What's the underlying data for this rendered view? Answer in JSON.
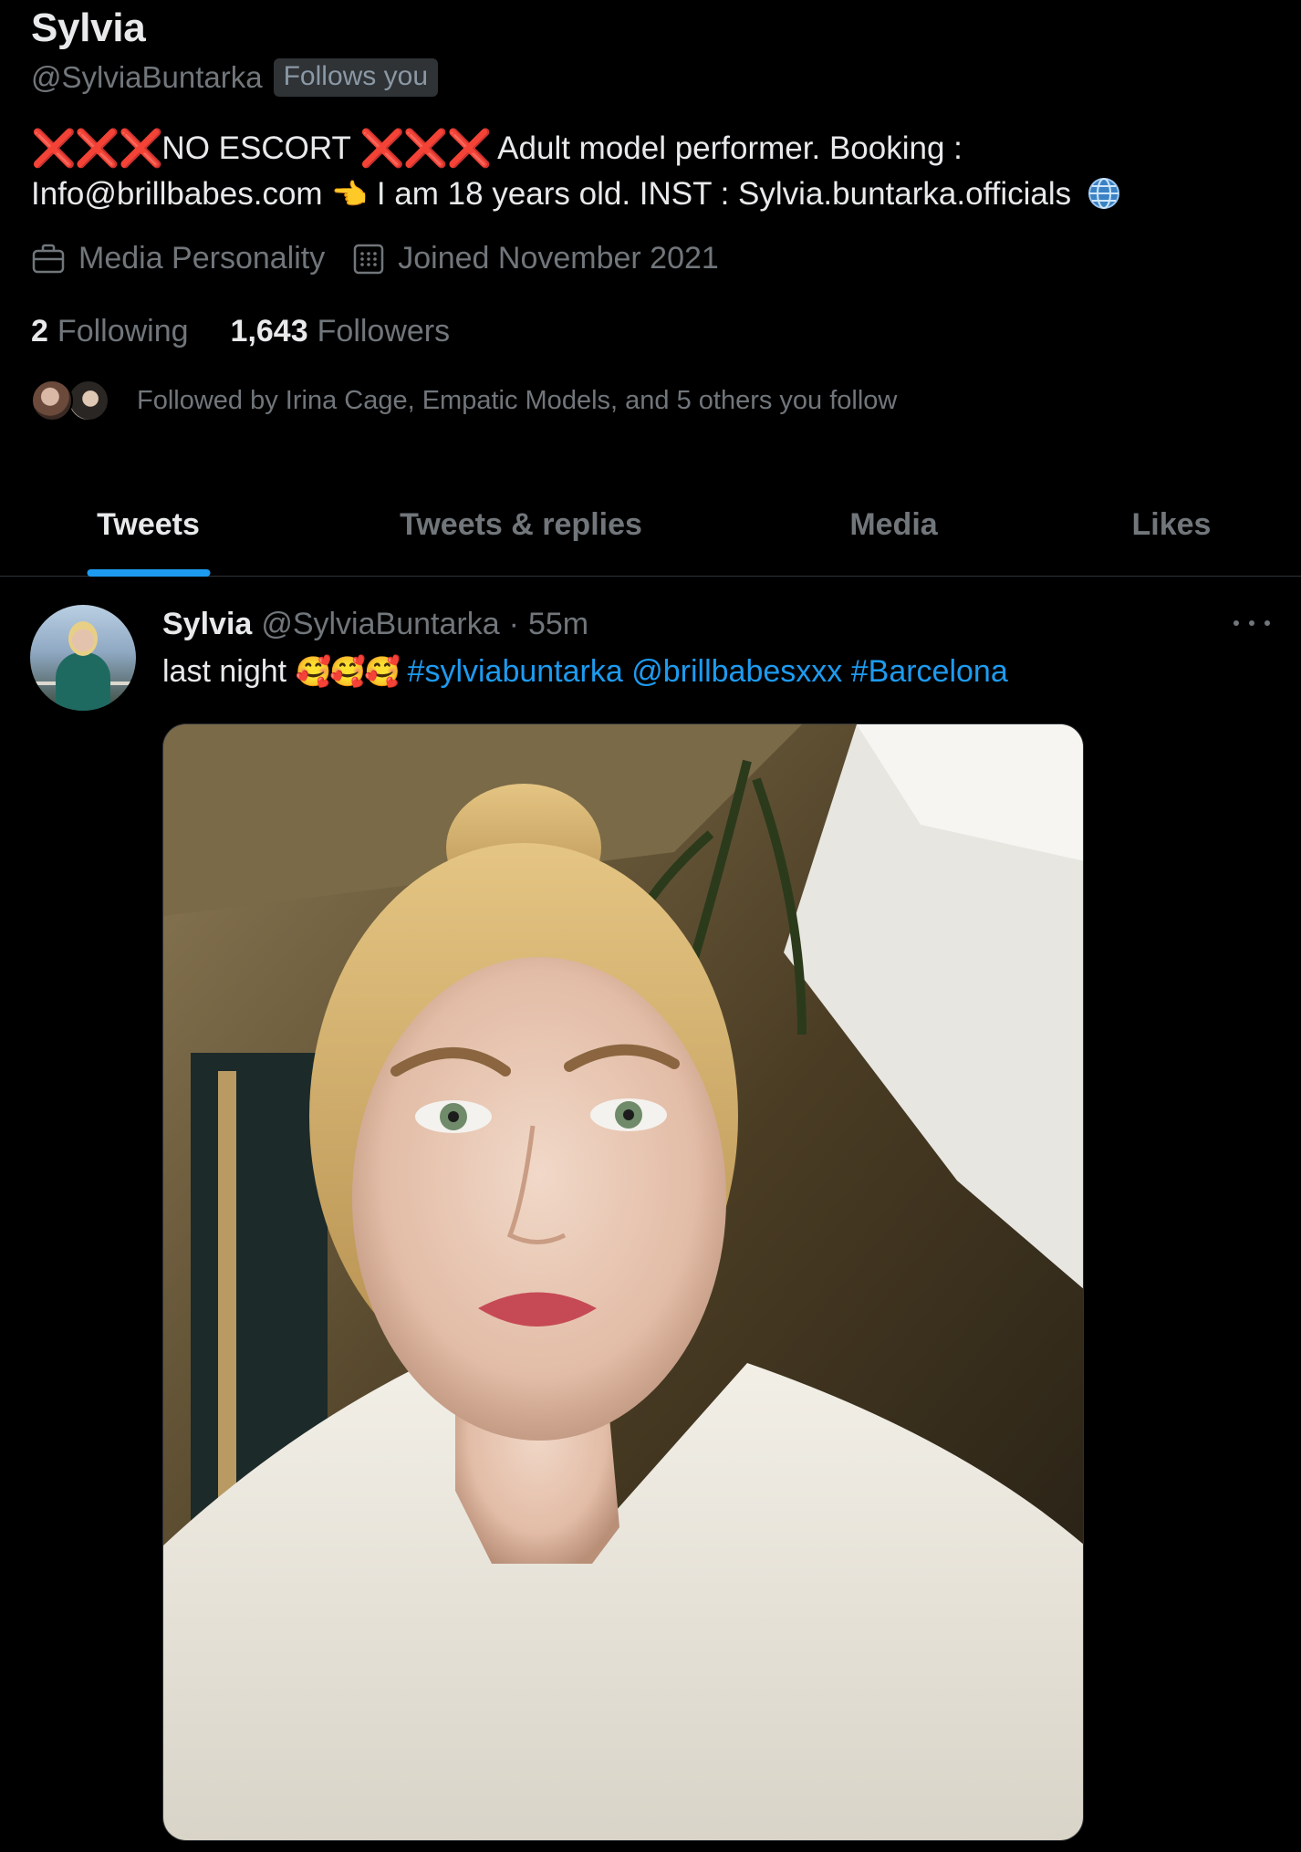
{
  "profile": {
    "name": "Sylvia",
    "handle": "@SylviaBuntarka",
    "follows_you": "Follows you",
    "bio": {
      "cross_marks": "❌❌❌",
      "part1": "NO ESCORT ",
      "part2": " Adult model performer. Booking :",
      "email": "Info@brillbabes.com",
      "point_emoji": "👈",
      "part3": " I am 18 years old. INST : Sylvia.buntarka.officials"
    },
    "category": "Media Personality",
    "joined": "Joined November 2021",
    "following_count": "2",
    "following_label": "Following",
    "followers_count": "1,643",
    "followers_label": "Followers",
    "followed_by": "Followed by Irina Cage, Empatic Models, and 5 others you follow"
  },
  "tabs": [
    {
      "label": "Tweets",
      "active": true
    },
    {
      "label": "Tweets & replies",
      "active": false
    },
    {
      "label": "Media",
      "active": false
    },
    {
      "label": "Likes",
      "active": false
    }
  ],
  "tweet": {
    "name": "Sylvia",
    "handle": "@SylviaBuntarka",
    "separator": "·",
    "time": "55m",
    "text": "last night",
    "emojis": "🥰🥰🥰",
    "hashtag1": "#sylviabuntarka",
    "mention": "@brillbabesxxx",
    "hashtag2": "#Barcelona"
  },
  "colors": {
    "background": "#000000",
    "text_primary": "#e7e9ea",
    "text_secondary": "#71767b",
    "accent": "#1d9bf0",
    "cross_red": "#e0223b",
    "divider": "#2f3336"
  },
  "icons": {
    "briefcase": "briefcase-icon",
    "calendar": "calendar-icon",
    "globe": "globe-icon",
    "more": "more-icon"
  }
}
